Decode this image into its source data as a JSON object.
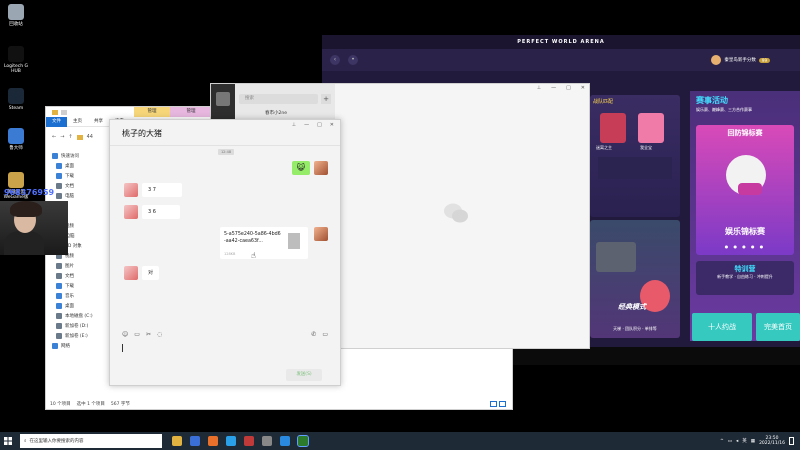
{
  "desktop": {
    "icons": [
      {
        "label": "回收站",
        "color": "#9aa7b3"
      },
      {
        "label": "Logitech G HUB",
        "color": "#111111"
      },
      {
        "label": "Steam",
        "color": "#1b2838"
      },
      {
        "label": "鲁大师",
        "color": "#3b7bd4"
      },
      {
        "label": "英雄联盟WeGame版",
        "color": "#c9a24a"
      }
    ],
    "watermark": "968376959"
  },
  "game": {
    "title": "PERFECT WORLD ARENA",
    "user_name": "秦皇岛新手分数",
    "level": "99",
    "card1_title": "战队匹配",
    "card1_items": [
      "迷离之主",
      "我全宝"
    ],
    "card2_title": "经典模式",
    "card2_tags": "天梯 · 团队积分 · 单排等",
    "side_title": "赛事活动",
    "side_sub": "娱乐赛、巅峰赛、三方合作赛事",
    "side_pink_label": "回防锦标赛",
    "side_pink_title": "娱乐锦标赛",
    "side_pink_dots": "● ● ● ● ●",
    "train_title": "特训营",
    "train_sub": "新手教学 · 自由练习 · 冲刺提升",
    "btn_ten": "十人约战",
    "btn_perfect": "完美首页"
  },
  "explorer": {
    "tabs": [
      "文件",
      "主页",
      "共享",
      "查看"
    ],
    "manage1": "管理",
    "manage2": "管理",
    "address": "44",
    "nav": [
      {
        "label": "快速访问",
        "color": "#3b82d6",
        "indent": false
      },
      {
        "label": "桌面",
        "color": "#3b82d6",
        "indent": true
      },
      {
        "label": "下载",
        "color": "#3b82d6",
        "indent": true
      },
      {
        "label": "文档",
        "color": "#6b7a8a",
        "indent": true
      },
      {
        "label": "电脑",
        "color": "#6b7a8a",
        "indent": true
      },
      {
        "label": "",
        "color": "#e3b341",
        "indent": true
      },
      {
        "label": "",
        "color": "#e3b341",
        "indent": true
      },
      {
        "label": "视频",
        "color": "#e3b341",
        "indent": true
      },
      {
        "label": "此电脑",
        "color": "#3b82d6",
        "indent": false
      },
      {
        "label": "3D 对象",
        "color": "#3b82d6",
        "indent": true
      },
      {
        "label": "视频",
        "color": "#6b7a8a",
        "indent": true
      },
      {
        "label": "图片",
        "color": "#6b7a8a",
        "indent": true
      },
      {
        "label": "文档",
        "color": "#6b7a8a",
        "indent": true
      },
      {
        "label": "下载",
        "color": "#3b82d6",
        "indent": true
      },
      {
        "label": "音乐",
        "color": "#3b82d6",
        "indent": true
      },
      {
        "label": "桌面",
        "color": "#3b82d6",
        "indent": true
      },
      {
        "label": "本地磁盘 (C:)",
        "color": "#6b7a8a",
        "indent": true
      },
      {
        "label": "新加卷 (D:)",
        "color": "#6b7a8a",
        "indent": true
      },
      {
        "label": "新加卷 (E:)",
        "color": "#6b7a8a",
        "indent": true
      },
      {
        "label": "网络",
        "color": "#3b82d6",
        "indent": false
      }
    ],
    "status_items": "10 个项目",
    "status_selected": "选中 1 个项目",
    "status_size": "567 字节"
  },
  "wechat_main": {
    "search_placeholder": "搜索",
    "plus": "+",
    "list_item": "春市小2ne",
    "controls": [
      "⊥",
      "—",
      "□",
      "✕"
    ]
  },
  "chat": {
    "title": "桃子的大猪",
    "controls": [
      "⊥",
      "—",
      "□",
      "✕"
    ],
    "time_label": "12:48",
    "messages": [
      {
        "text": "3 7"
      },
      {
        "text": "3 6"
      },
      {
        "text": "对"
      }
    ],
    "me_emoji": "😺",
    "file_name": "5-a575e240-5a86-4bd6-aa42-caea63f...",
    "file_size": "128KB",
    "send_label": "发送(S)",
    "tools": [
      "☺",
      "▭",
      "✂",
      "◌"
    ],
    "tools_right": [
      "✆",
      "▭"
    ]
  },
  "taskbar": {
    "search_placeholder": "在这里输入你要搜索的内容",
    "time": "23:50",
    "date": "2022/11/16",
    "tray": [
      "^",
      "▭",
      "◂",
      "英",
      "▦"
    ],
    "apps": [
      {
        "color": "#e3b341",
        "active": false
      },
      {
        "color": "#3a6fd8",
        "active": false
      },
      {
        "color": "#e8702a",
        "active": false
      },
      {
        "color": "#2aa0e8",
        "active": false
      },
      {
        "color": "#c03a3a",
        "active": false
      },
      {
        "color": "#888888",
        "active": false
      },
      {
        "color": "#2a8adf",
        "active": false
      },
      {
        "color": "#2c7a2c",
        "active": true
      }
    ]
  }
}
